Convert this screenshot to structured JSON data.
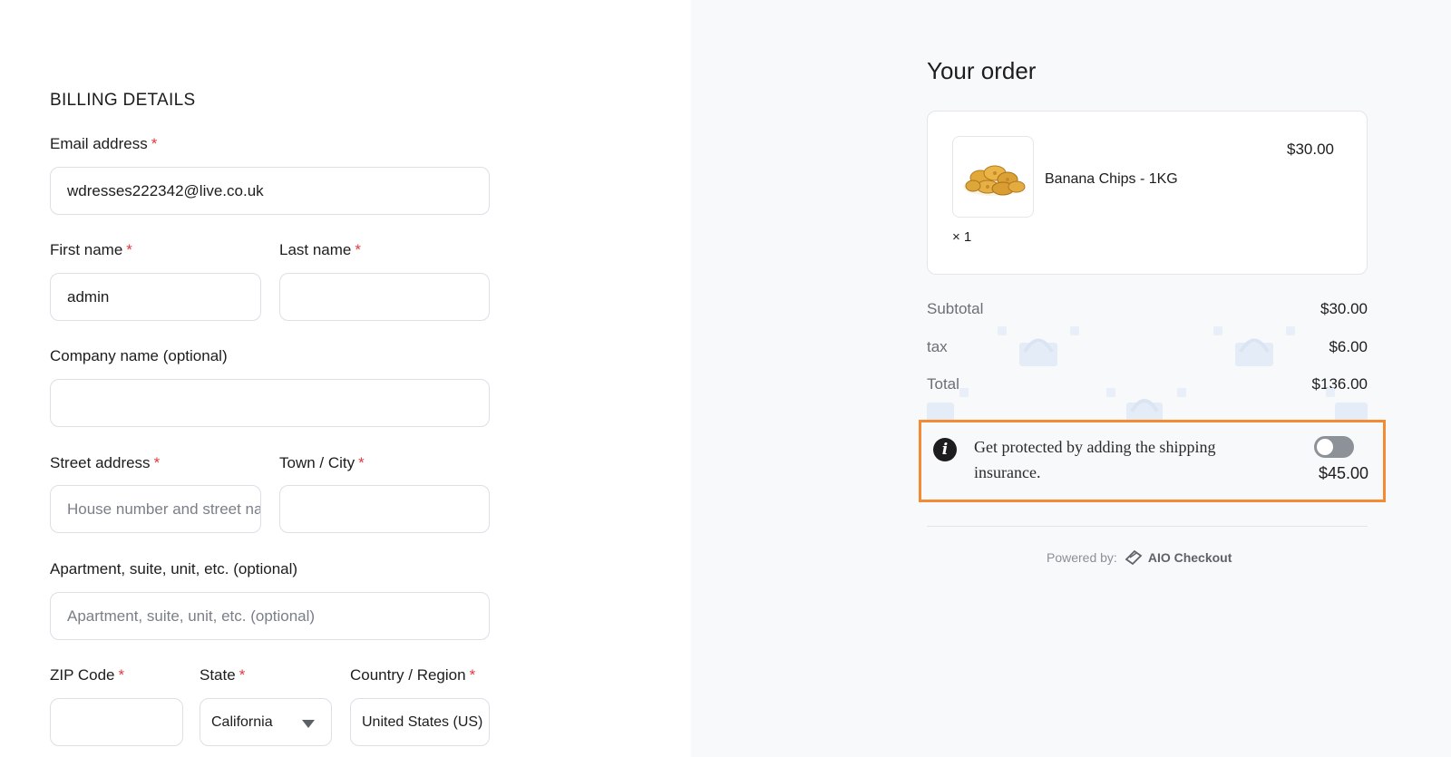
{
  "billing": {
    "title": "BILLING DETAILS",
    "required_mark": "*",
    "email": {
      "label": "Email address",
      "value": "wdresses222342@live.co.uk"
    },
    "first_name": {
      "label": "First name",
      "value": "admin"
    },
    "last_name": {
      "label": "Last name",
      "value": ""
    },
    "company": {
      "label": "Company name (optional)",
      "value": ""
    },
    "street": {
      "label": "Street address",
      "placeholder": "House number and street name"
    },
    "city": {
      "label": "Town / City",
      "value": ""
    },
    "apartment": {
      "label": "Apartment, suite, unit, etc. (optional)",
      "placeholder": "Apartment, suite, unit, etc. (optional)"
    },
    "zip": {
      "label": "ZIP Code",
      "value": ""
    },
    "state": {
      "label": "State",
      "value": "California"
    },
    "country": {
      "label": "Country / Region",
      "value": "United States (US)"
    }
  },
  "order": {
    "title": "Your order",
    "item": {
      "name": "Banana Chips - 1KG",
      "price": "$30.00",
      "quantity": "× 1",
      "image_icon": "banana-chips-image"
    },
    "summary": [
      {
        "key": "Subtotal",
        "value": "$30.00"
      },
      {
        "key": "tax",
        "value": "$6.00"
      },
      {
        "key": "Total",
        "value": "$136.00"
      }
    ],
    "insurance": {
      "text": "Get protected by adding the shipping insurance.",
      "price": "$45.00",
      "enabled": false,
      "icon": "info-icon"
    },
    "powered_by": {
      "label": "Powered by:",
      "brand": "AIO Checkout"
    }
  },
  "colors": {
    "required": "#e0393e",
    "highlight_border": "#f28b34",
    "right_panel_bg": "#f8f9fb",
    "toggle_off": "#8d9198"
  }
}
